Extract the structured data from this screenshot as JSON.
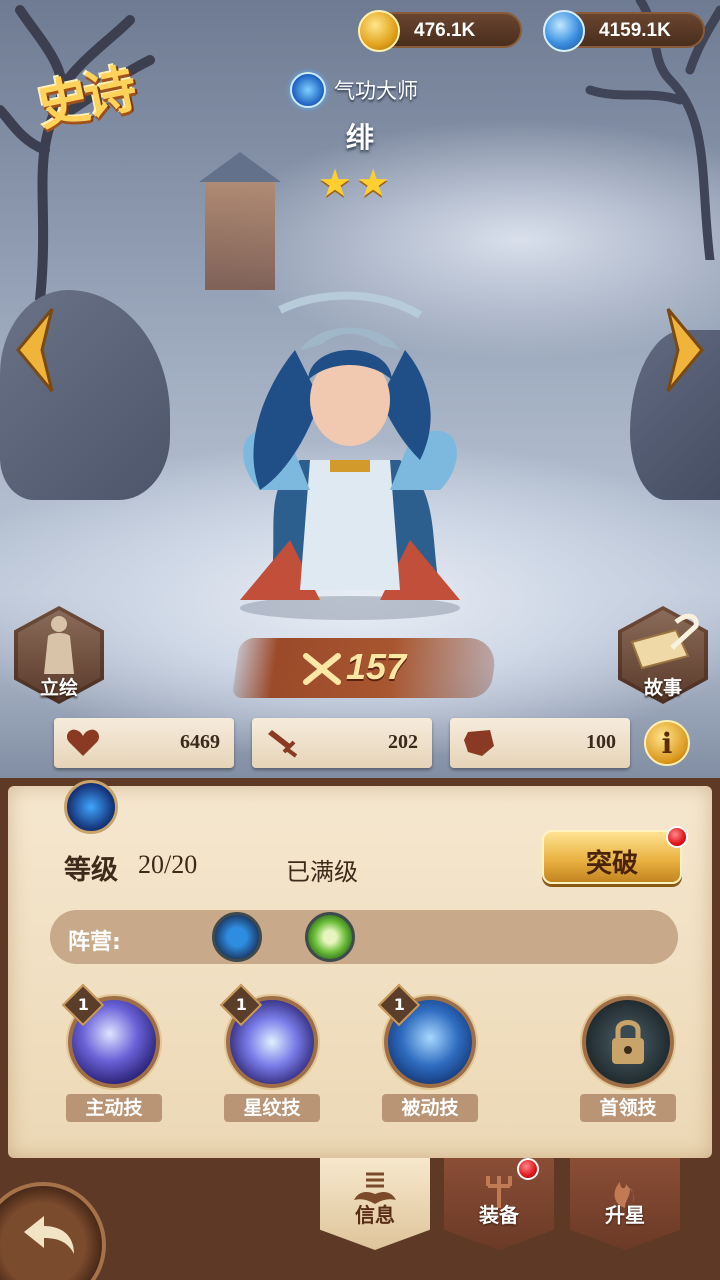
{
  "resources": {
    "gold": "476.1K",
    "gems": "4159.1K"
  },
  "rarity": "史诗",
  "hero": {
    "class_name": "气功大师",
    "name": "绯",
    "stars": 2,
    "star_glyph": "★"
  },
  "side_buttons": {
    "portrait": "立绘",
    "story": "故事"
  },
  "power": "157",
  "stats": {
    "hp": "6469",
    "attack": "202",
    "defense": "100"
  },
  "info_label": "i",
  "level": {
    "label": "等级",
    "value": "20/20",
    "status": "已满级"
  },
  "breakthrough_label": "突破",
  "camp_label": "阵营:",
  "skills": [
    {
      "name": "主动技",
      "level": "1"
    },
    {
      "name": "星纹技",
      "level": "1"
    },
    {
      "name": "被动技",
      "level": "1"
    },
    {
      "name": "首领技",
      "level": ""
    }
  ],
  "tabs": [
    {
      "label": "信息",
      "active": true
    },
    {
      "label": "装备",
      "active": false
    },
    {
      "label": "升星",
      "active": false
    }
  ],
  "colors": {
    "accent_gold": "#ffd25a",
    "panel": "#f5e7cf",
    "tab_inactive": "#8a4e36",
    "notify_red": "#e0141a"
  }
}
